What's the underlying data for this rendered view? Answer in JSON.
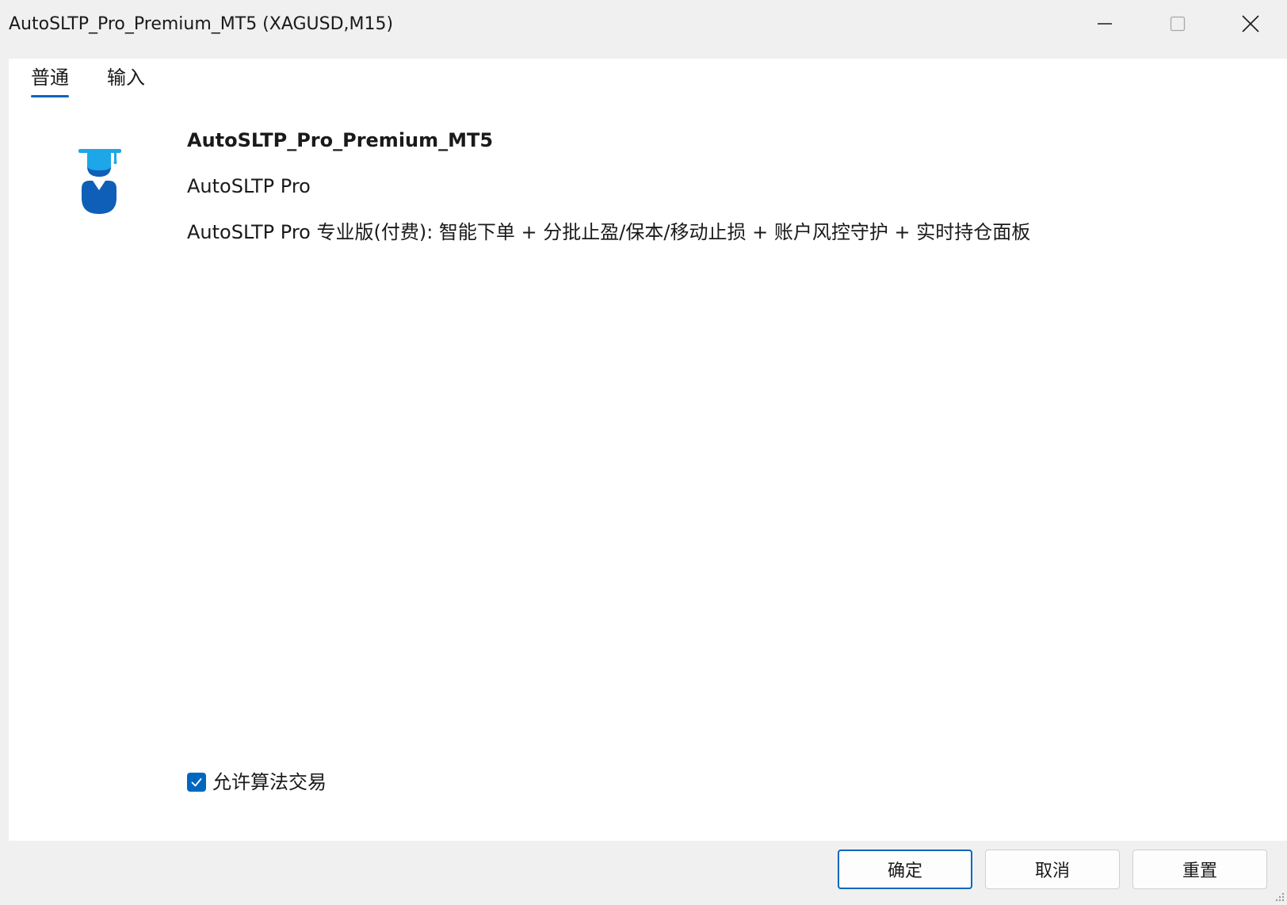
{
  "window": {
    "title": "AutoSLTP_Pro_Premium_MT5 (XAGUSD,M15)"
  },
  "tabs": [
    {
      "label": "普通",
      "active": true
    },
    {
      "label": "输入",
      "active": false
    }
  ],
  "expert": {
    "icon": "graduate-user-icon",
    "name": "AutoSLTP_Pro_Premium_MT5",
    "short_name": "AutoSLTP Pro",
    "description": "AutoSLTP Pro 专业版(付费): 智能下单 + 分批止盈/保本/移动止损 + 账户风控守护 + 实时持仓面板"
  },
  "options": {
    "allow_algo_trading": {
      "label": "允许算法交易",
      "checked": true
    }
  },
  "buttons": {
    "ok": "确定",
    "cancel": "取消",
    "reset": "重置"
  },
  "colors": {
    "accent": "#0067c0",
    "icon_light": "#1ea7e8",
    "icon_dark": "#0f5fb8"
  }
}
